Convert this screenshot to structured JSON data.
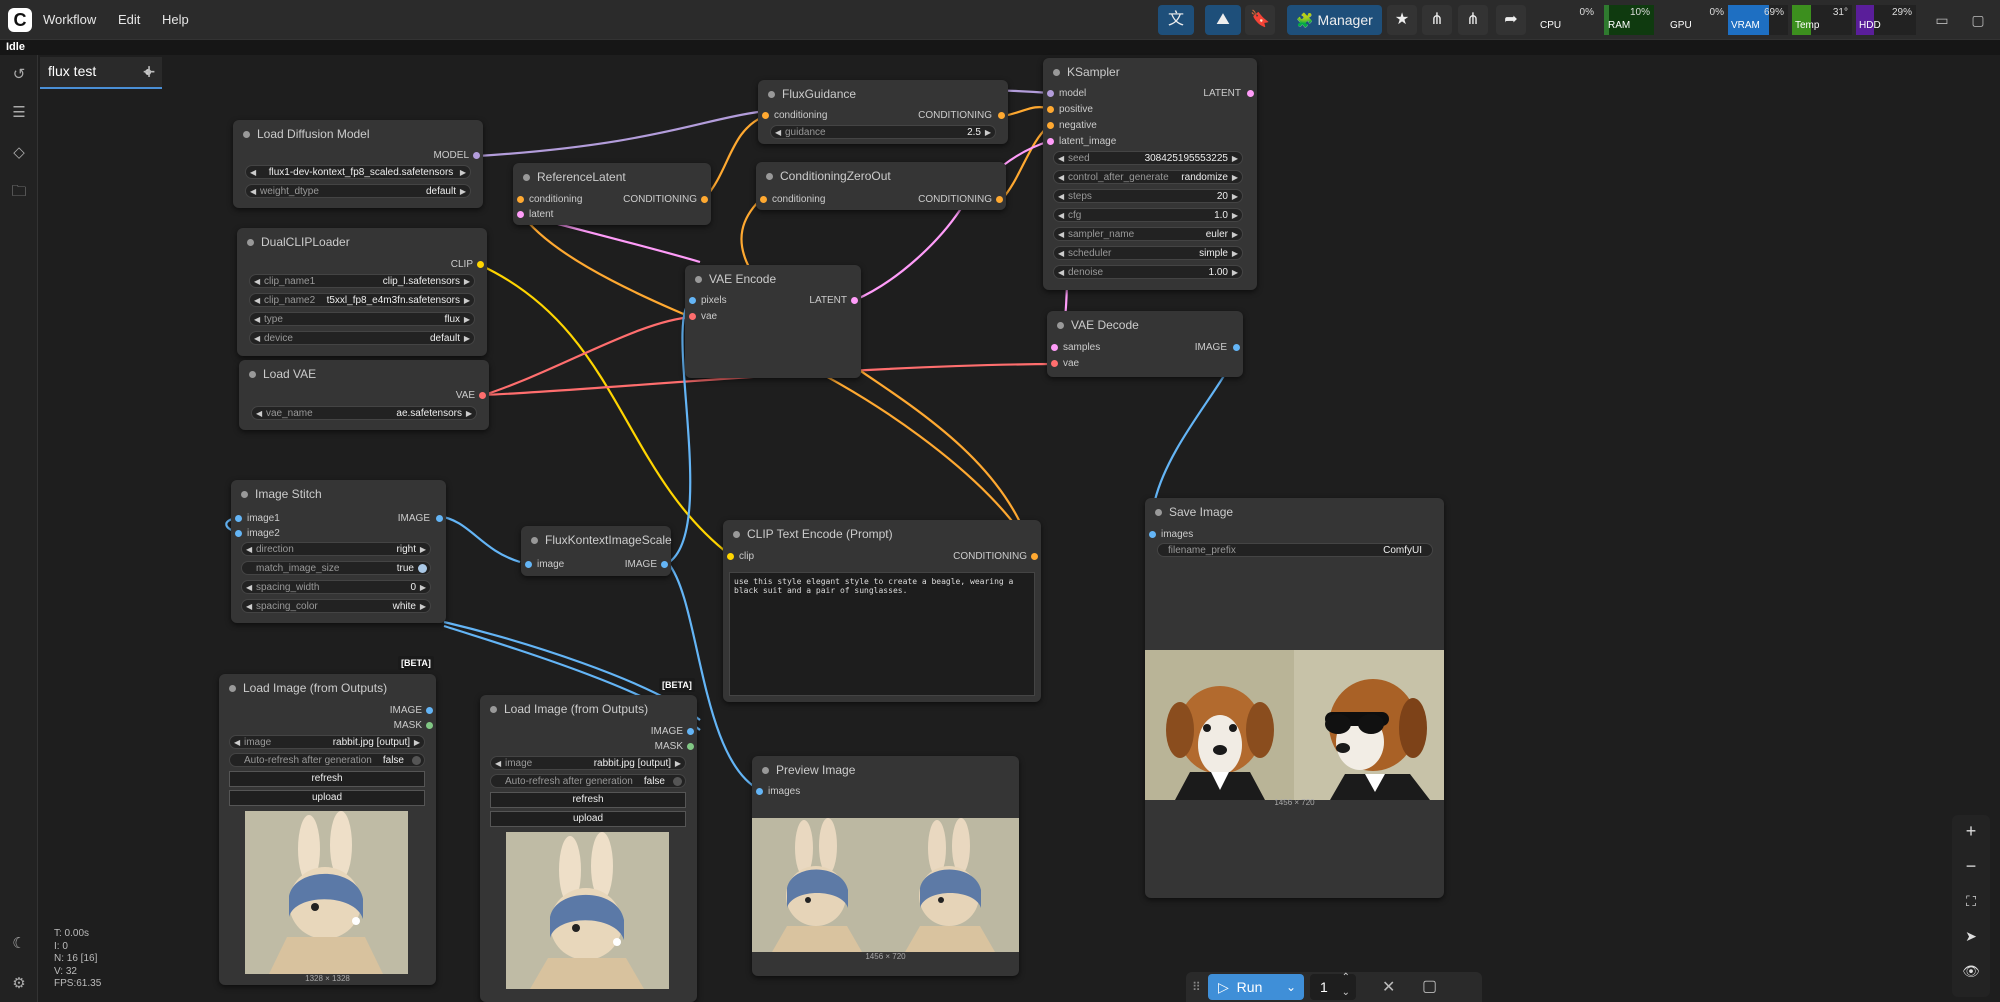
{
  "menu": {
    "workflow": "Workflow",
    "edit": "Edit",
    "help": "Help"
  },
  "toolbar": {
    "manager": "Manager"
  },
  "stats": [
    {
      "label": "CPU",
      "value": "0%",
      "color": "#2b2b2b"
    },
    {
      "label": "RAM",
      "value": "10%",
      "color": "#1d4d1d"
    },
    {
      "label": "GPU",
      "value": "0%",
      "color": "#2b2b2b"
    },
    {
      "label": "VRAM",
      "value": "69%",
      "color": "#1e6fc2"
    },
    {
      "label": "Temp",
      "value": "31°",
      "color": "#3c8f1e"
    },
    {
      "label": "HDD",
      "value": "29%",
      "color": "#5a1e9a"
    }
  ],
  "status": "Idle",
  "tab": {
    "name": "flux test"
  },
  "colors": {
    "model": "#b39ddb",
    "clip": "#ffd500",
    "vae": "#ff6e6e",
    "conditioning": "#ffa931",
    "latent": "#ff9cf9",
    "image": "#64b5f6",
    "mask": "#81c784",
    "accent": "#4a8fd6"
  },
  "nodes": {
    "load_diffusion": {
      "title": "Load Diffusion Model",
      "out_model": "MODEL",
      "unet_name": "flux1-dev-kontext_fp8_scaled.safetensors",
      "weight_label": "weight_dtype",
      "weight_value": "default"
    },
    "dual_clip": {
      "title": "DualCLIPLoader",
      "out_clip": "CLIP",
      "w1_label": "clip_name1",
      "w1_value": "clip_l.safetensors",
      "w2_label": "clip_name2",
      "w2_value": "t5xxl_fp8_e4m3fn.safetensors",
      "w3_label": "type",
      "w3_value": "flux",
      "w4_label": "device",
      "w4_value": "default"
    },
    "load_vae": {
      "title": "Load VAE",
      "out_vae": "VAE",
      "w_label": "vae_name",
      "w_value": "ae.safetensors"
    },
    "reference_latent": {
      "title": "ReferenceLatent",
      "in1": "conditioning",
      "in2": "latent",
      "out": "CONDITIONING"
    },
    "flux_guidance": {
      "title": "FluxGuidance",
      "in1": "conditioning",
      "out": "CONDITIONING",
      "w_label": "guidance",
      "w_value": "2.5"
    },
    "cond_zero": {
      "title": "ConditioningZeroOut",
      "in1": "conditioning",
      "out": "CONDITIONING"
    },
    "vae_encode": {
      "title": "VAE Encode",
      "in1": "pixels",
      "in2": "vae",
      "out": "LATENT"
    },
    "ksampler": {
      "title": "KSampler",
      "in1": "model",
      "in2": "positive",
      "in3": "negative",
      "in4": "latent_image",
      "out": "LATENT",
      "widgets": [
        {
          "label": "seed",
          "value": "308425195553225"
        },
        {
          "label": "control_after_generate",
          "value": "randomize"
        },
        {
          "label": "steps",
          "value": "20"
        },
        {
          "label": "cfg",
          "value": "1.0"
        },
        {
          "label": "sampler_name",
          "value": "euler"
        },
        {
          "label": "scheduler",
          "value": "simple"
        },
        {
          "label": "denoise",
          "value": "1.00"
        }
      ]
    },
    "vae_decode": {
      "title": "VAE Decode",
      "in1": "samples",
      "in2": "vae",
      "out": "IMAGE"
    },
    "image_stitch": {
      "title": "Image Stitch",
      "in1": "image1",
      "in2": "image2",
      "out": "IMAGE",
      "w1_label": "direction",
      "w1_value": "right",
      "w2_label": "match_image_size",
      "w2_value": "true",
      "w3_label": "spacing_width",
      "w3_value": "0",
      "w4_label": "spacing_color",
      "w4_value": "white"
    },
    "flux_kontext_scale": {
      "title": "FluxKontextImageScale",
      "in1": "image",
      "out": "IMAGE"
    },
    "clip_text": {
      "title": "CLIP Text Encode (Prompt)",
      "in1": "clip",
      "out": "CONDITIONING",
      "text": "use this style elegant style to create a beagle, wearing a black suit and a pair of sunglasses."
    },
    "save_image": {
      "title": "Save Image",
      "in1": "images",
      "w_label": "filename_prefix",
      "w_value": "ComfyUI",
      "dims": "1456 × 720"
    },
    "preview_image": {
      "title": "Preview Image",
      "in1": "images",
      "dims": "1456 × 720"
    },
    "load_image_1": {
      "badge": "[BETA]",
      "title": "Load Image (from Outputs)",
      "out1": "IMAGE",
      "out2": "MASK",
      "w_label": "image",
      "w_value": "rabbit.jpg [output]",
      "toggle_label": "Auto-refresh after generation",
      "toggle_value": "false",
      "btn1": "refresh",
      "btn2": "upload",
      "dims": "1328 × 1328"
    },
    "load_image_2": {
      "badge": "[BETA]",
      "title": "Load Image (from Outputs)",
      "out1": "IMAGE",
      "out2": "MASK",
      "w_label": "image",
      "w_value": "rabbit.jpg [output]",
      "toggle_label": "Auto-refresh after generation",
      "toggle_value": "false",
      "btn1": "refresh",
      "btn2": "upload",
      "dims": "1328 × 1328"
    }
  },
  "run": {
    "label": "Run",
    "count": "1"
  },
  "perf": {
    "t": "T: 0.00s",
    "i": "I: 0",
    "n": "N: 16 [16]",
    "v": "V: 32",
    "fps": "FPS:61.35"
  }
}
